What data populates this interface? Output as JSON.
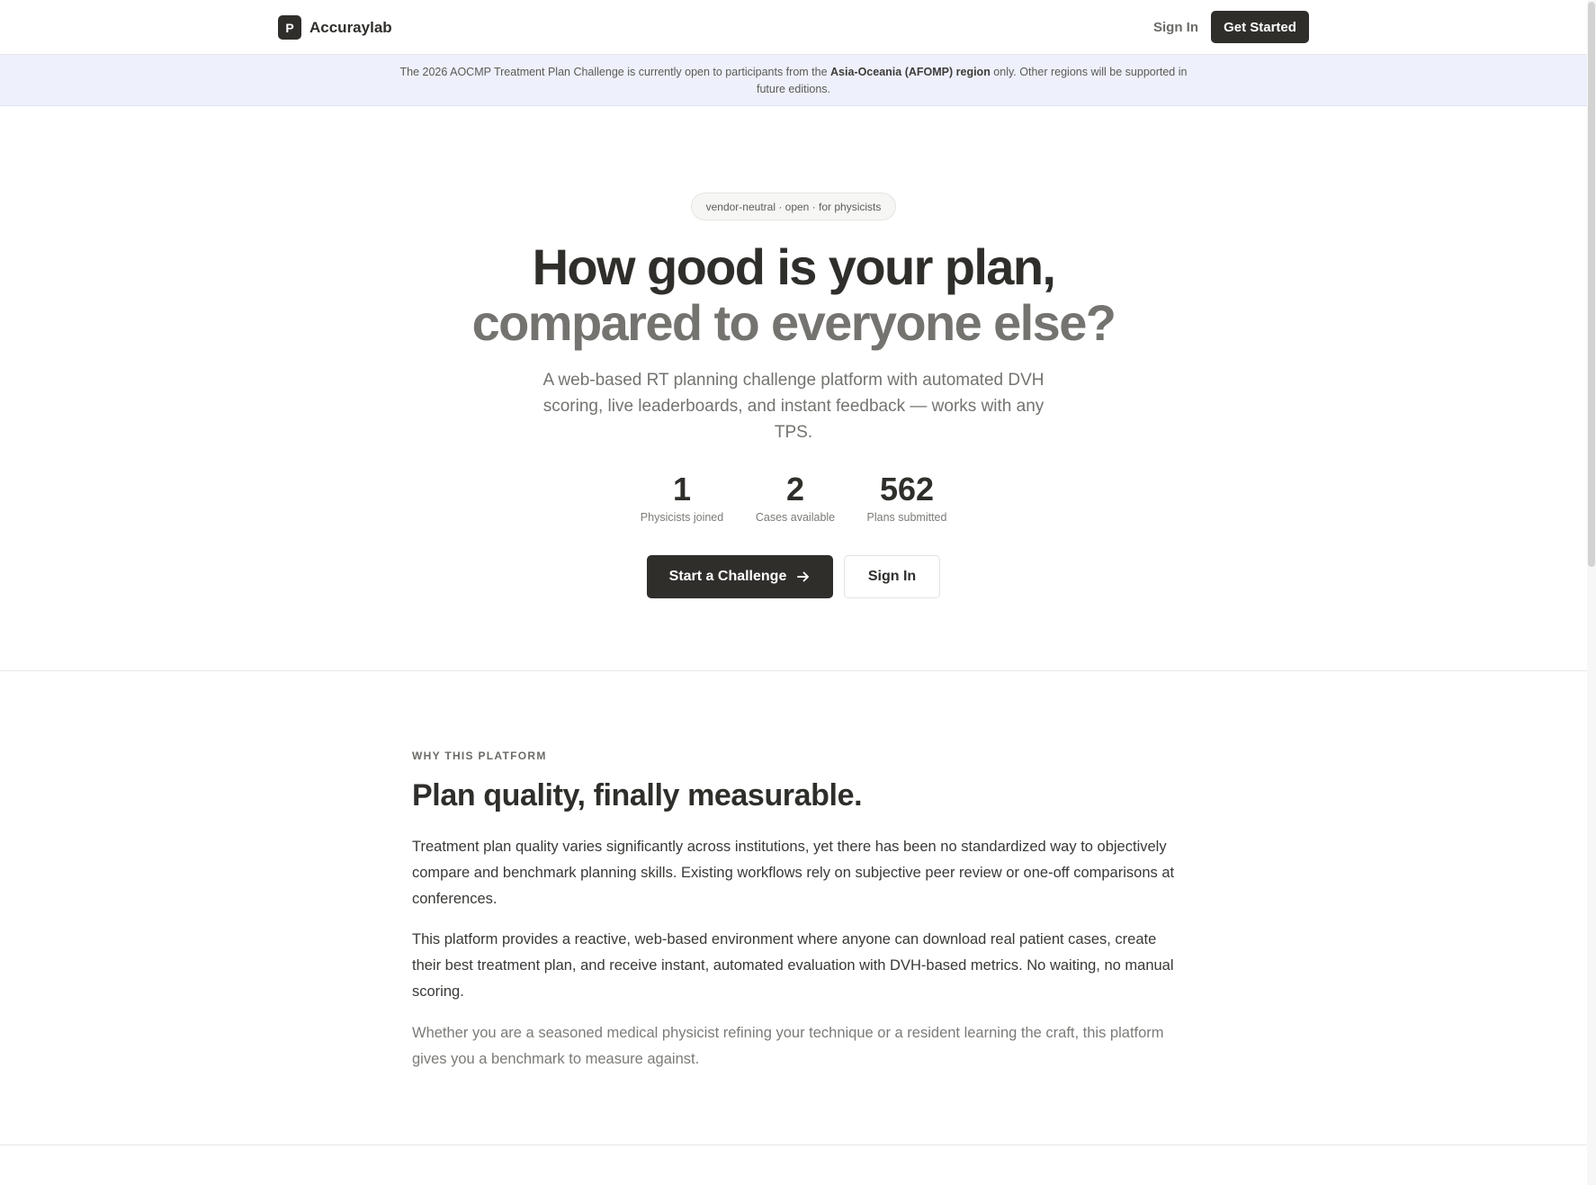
{
  "header": {
    "logo_letter": "P",
    "brand": "Accuraylab",
    "signin_label": "Sign In",
    "get_started_label": "Get Started"
  },
  "banner": {
    "text_before": "The 2026 AOCMP Treatment Plan Challenge is currently open to participants from the ",
    "region": "Asia-Oceania (AFOMP) region",
    "text_after": " only. Other regions will be supported in future editions."
  },
  "hero": {
    "pill": "vendor-neutral · open · for physicists",
    "title_line1": "How good is your plan,",
    "title_line2": "compared to everyone else?",
    "subtitle": "A web-based RT planning challenge platform with automated DVH scoring, live leaderboards, and instant feedback — works with any TPS.",
    "stats": [
      {
        "value": "1",
        "label": "Physicists joined"
      },
      {
        "value": "2",
        "label": "Cases available"
      },
      {
        "value": "562",
        "label": "Plans submitted"
      }
    ],
    "primary_cta": "Start a Challenge",
    "secondary_cta": "Sign In"
  },
  "why": {
    "eyebrow": "WHY THIS PLATFORM",
    "title": "Plan quality, finally measurable.",
    "paragraphs": [
      "Treatment plan quality varies significantly across institutions, yet there has been no standardized way to objectively compare and benchmark planning skills. Existing workflows rely on subjective peer review or one-off comparisons at conferences.",
      "This platform provides a reactive, web-based environment where anyone can download real patient cases, create their best treatment plan, and receive instant, automated evaluation with DVH-based metrics. No waiting, no manual scoring.",
      "Whether you are a seasoned medical physicist refining your technique or a resident learning the craft, this platform gives you a benchmark to measure against."
    ]
  },
  "colors": {
    "ink": "#2f2e2b",
    "muted": "#74736f",
    "banner_bg": "#eef1fb"
  },
  "icons": {
    "cta_arrow": "arrow-right-icon"
  }
}
